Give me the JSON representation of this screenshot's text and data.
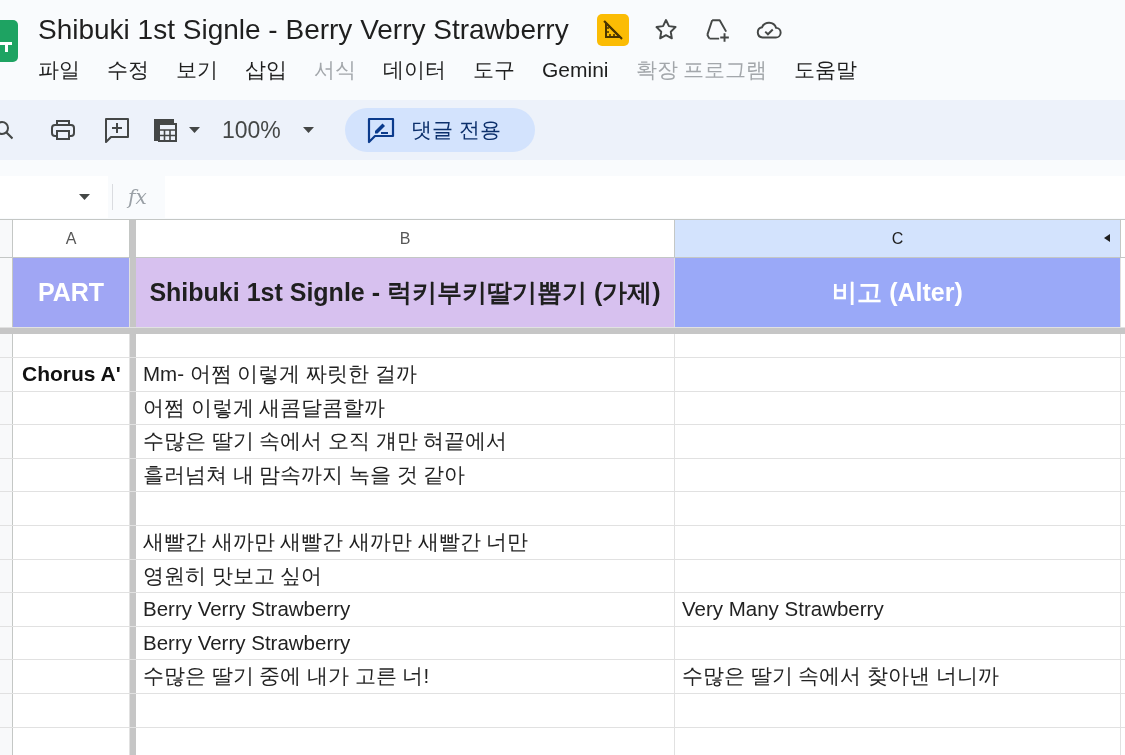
{
  "document": {
    "title": "Shibuki 1st Signle - Berry Verry Strawberry"
  },
  "menu": [
    {
      "label": "파일",
      "disabled": false
    },
    {
      "label": "수정",
      "disabled": false
    },
    {
      "label": "보기",
      "disabled": false
    },
    {
      "label": "삽입",
      "disabled": false
    },
    {
      "label": "서식",
      "disabled": true
    },
    {
      "label": "데이터",
      "disabled": false
    },
    {
      "label": "도구",
      "disabled": false
    },
    {
      "label": "Gemini",
      "disabled": false
    },
    {
      "label": "확장 프로그램",
      "disabled": true
    },
    {
      "label": "도움말",
      "disabled": false
    }
  ],
  "toolbar": {
    "zoom": "100%",
    "mode_button": "댓글 전용"
  },
  "formula_bar": {
    "fx_label": "fx"
  },
  "columns": [
    {
      "label": "A",
      "selected": false
    },
    {
      "label": "B",
      "selected": false
    },
    {
      "label": "C",
      "selected": true
    }
  ],
  "header_row": [
    {
      "text": "PART",
      "color": "#a0a6f4"
    },
    {
      "text": "Shibuki 1st Signle - 럭키부키딸기뽑기 (가제)",
      "color": "#d7c1ef"
    },
    {
      "text": "비고 (Alter)",
      "color": "#9aa9f8"
    }
  ],
  "rows": [
    {},
    {
      "a": "Chorus A'",
      "b": "Mm- 어쩜 이렇게 짜릿한 걸까"
    },
    {
      "b": "어쩜 이렇게 새콤달콤할까"
    },
    {
      "b": "수많은 딸기 속에서 오직 걔만 혀끝에서"
    },
    {
      "b": "흘러넘쳐 내 맘속까지 녹을 것 같아"
    },
    {},
    {
      "b": "새빨간 새까만 새빨간 새까만 새빨간 너만"
    },
    {
      "b": "영원히 맛보고 싶어"
    },
    {
      "b": "Berry Verry Strawberry",
      "c": "Very Many Strawberry"
    },
    {
      "b": "Berry Verry Strawberry"
    },
    {
      "b": "수많은 딸기 중에 내가 고른 너!",
      "c": "수많은 딸기 속에서 찾아낸 너니까"
    },
    {},
    {}
  ]
}
